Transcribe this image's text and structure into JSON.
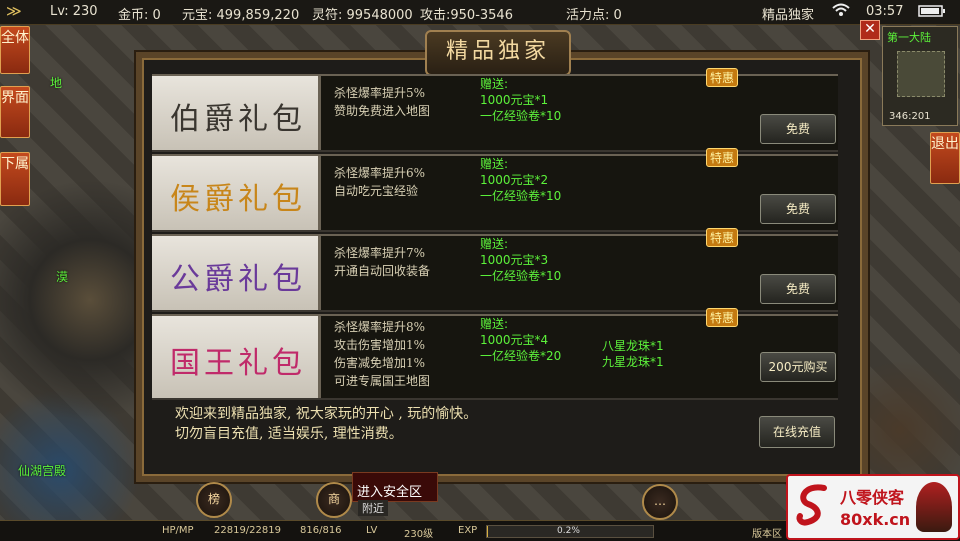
{
  "status_bar": {
    "level": "Lv: 230",
    "gold": "金币: 0",
    "yuanbao": "元宝: 499,859,220",
    "lingfu": "灵符: 99548000",
    "attack": "攻击:950-3546",
    "activity": "活力点: 0",
    "current_window": "精品独家",
    "time": "03:57"
  },
  "left_tabs": [
    "全体",
    "界面",
    "下属"
  ],
  "exit_button": "退出",
  "panel": {
    "title": "精品独家",
    "packages": [
      {
        "name": "伯爵礼包",
        "perks": [
          "杀怪爆率提升5%",
          "赞助免费进入地图"
        ],
        "gift_label": "赠送:",
        "gifts": [
          "1000元宝*1",
          "一亿经验卷*10"
        ],
        "extra_gifts": [],
        "badge": "特惠",
        "button": "免费"
      },
      {
        "name": "侯爵礼包",
        "perks": [
          "杀怪爆率提升6%",
          "自动吃元宝经验"
        ],
        "gift_label": "赠送:",
        "gifts": [
          "1000元宝*2",
          "一亿经验卷*10"
        ],
        "extra_gifts": [],
        "badge": "特惠",
        "button": "免费"
      },
      {
        "name": "公爵礼包",
        "perks": [
          "杀怪爆率提升7%",
          "开通自动回收装备"
        ],
        "gift_label": "赠送:",
        "gifts": [
          "1000元宝*3",
          "一亿经验卷*10"
        ],
        "extra_gifts": [],
        "badge": "特惠",
        "button": "免费"
      },
      {
        "name": "国王礼包",
        "perks": [
          "杀怪爆率提升8%",
          "攻击伤害增加1%",
          "伤害减免增加1%",
          "可进专属国王地图"
        ],
        "gift_label": "赠送:",
        "gifts": [
          "1000元宝*4",
          "一亿经验卷*20"
        ],
        "extra_gifts": [
          "八星龙珠*1",
          "九星龙珠*1"
        ],
        "badge": "特惠",
        "button": "200元购买"
      }
    ],
    "welcome_lines": [
      "欢迎来到精品独家, 祝大家玩的开心 , 玩的愉快。",
      "切勿盲目充值, 适当娱乐, 理性消费。"
    ],
    "recharge_button": "在线充值"
  },
  "minimap": {
    "map_name": "第一大陆",
    "coords": "346:201"
  },
  "map_labels": {
    "city": "仙湖宫殿",
    "npc1": "漠",
    "npc2": "地"
  },
  "chat": {
    "tab": "附近",
    "message": "进入安全区"
  },
  "round_buttons": {
    "rank": "榜",
    "shop": "商"
  },
  "bottom_bar": {
    "hpmp_label": "HP/MP",
    "hp": "22819/22819",
    "mp": "816/816",
    "lv_label": "LV",
    "lv_value": "230级",
    "exp_label": "EXP",
    "exp_value": "0.2%",
    "exp_progress": 0.002,
    "version": "版本区"
  },
  "watermark": {
    "brand": "八零侠客",
    "site": "80xk.cn"
  },
  "colors": {
    "accent_green": "#5cf23a",
    "gold_text": "#f2d8a0",
    "red_tab": "#c44a1e"
  },
  "icons": [
    "back-arrow-icon",
    "wifi-icon",
    "battery-icon",
    "close-icon",
    "chat-bubble-icon"
  ]
}
